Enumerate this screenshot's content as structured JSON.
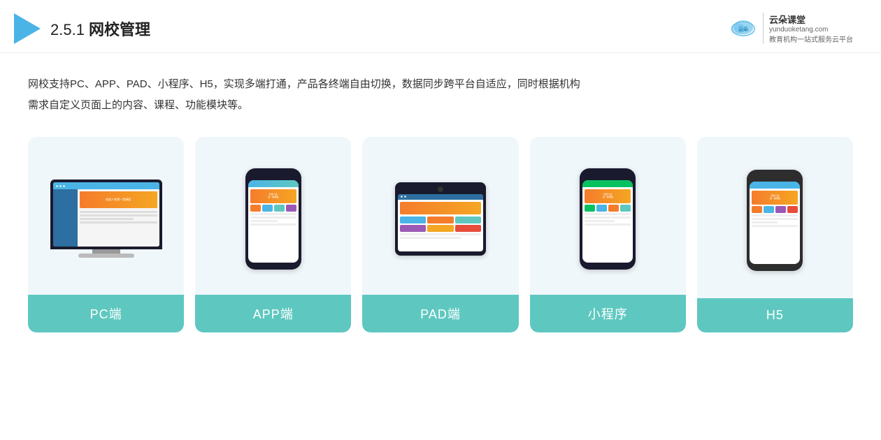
{
  "header": {
    "section_number": "2.5.1",
    "title_prefix": "2.5.1 ",
    "title_bold": "网校管理",
    "brand": {
      "name": "云朵课堂",
      "domain": "yunduoketang.com",
      "tagline_line1": "教育机构一站",
      "tagline_line2": "式服务云平台"
    }
  },
  "description": {
    "line1": "网校支持PC、APP、PAD、小程序、H5，实现多端打通，产品各终端自由切换，数据同步跨平台自适应，同时根据机构",
    "line2": "需求自定义页面上的内容、课程、功能模块等。"
  },
  "cards": [
    {
      "id": "pc",
      "label": "PC端",
      "device_type": "desktop"
    },
    {
      "id": "app",
      "label": "APP端",
      "device_type": "phone"
    },
    {
      "id": "pad",
      "label": "PAD端",
      "device_type": "tablet"
    },
    {
      "id": "miniprogram",
      "label": "小程序",
      "device_type": "phone"
    },
    {
      "id": "h5",
      "label": "H5",
      "device_type": "phone"
    }
  ]
}
